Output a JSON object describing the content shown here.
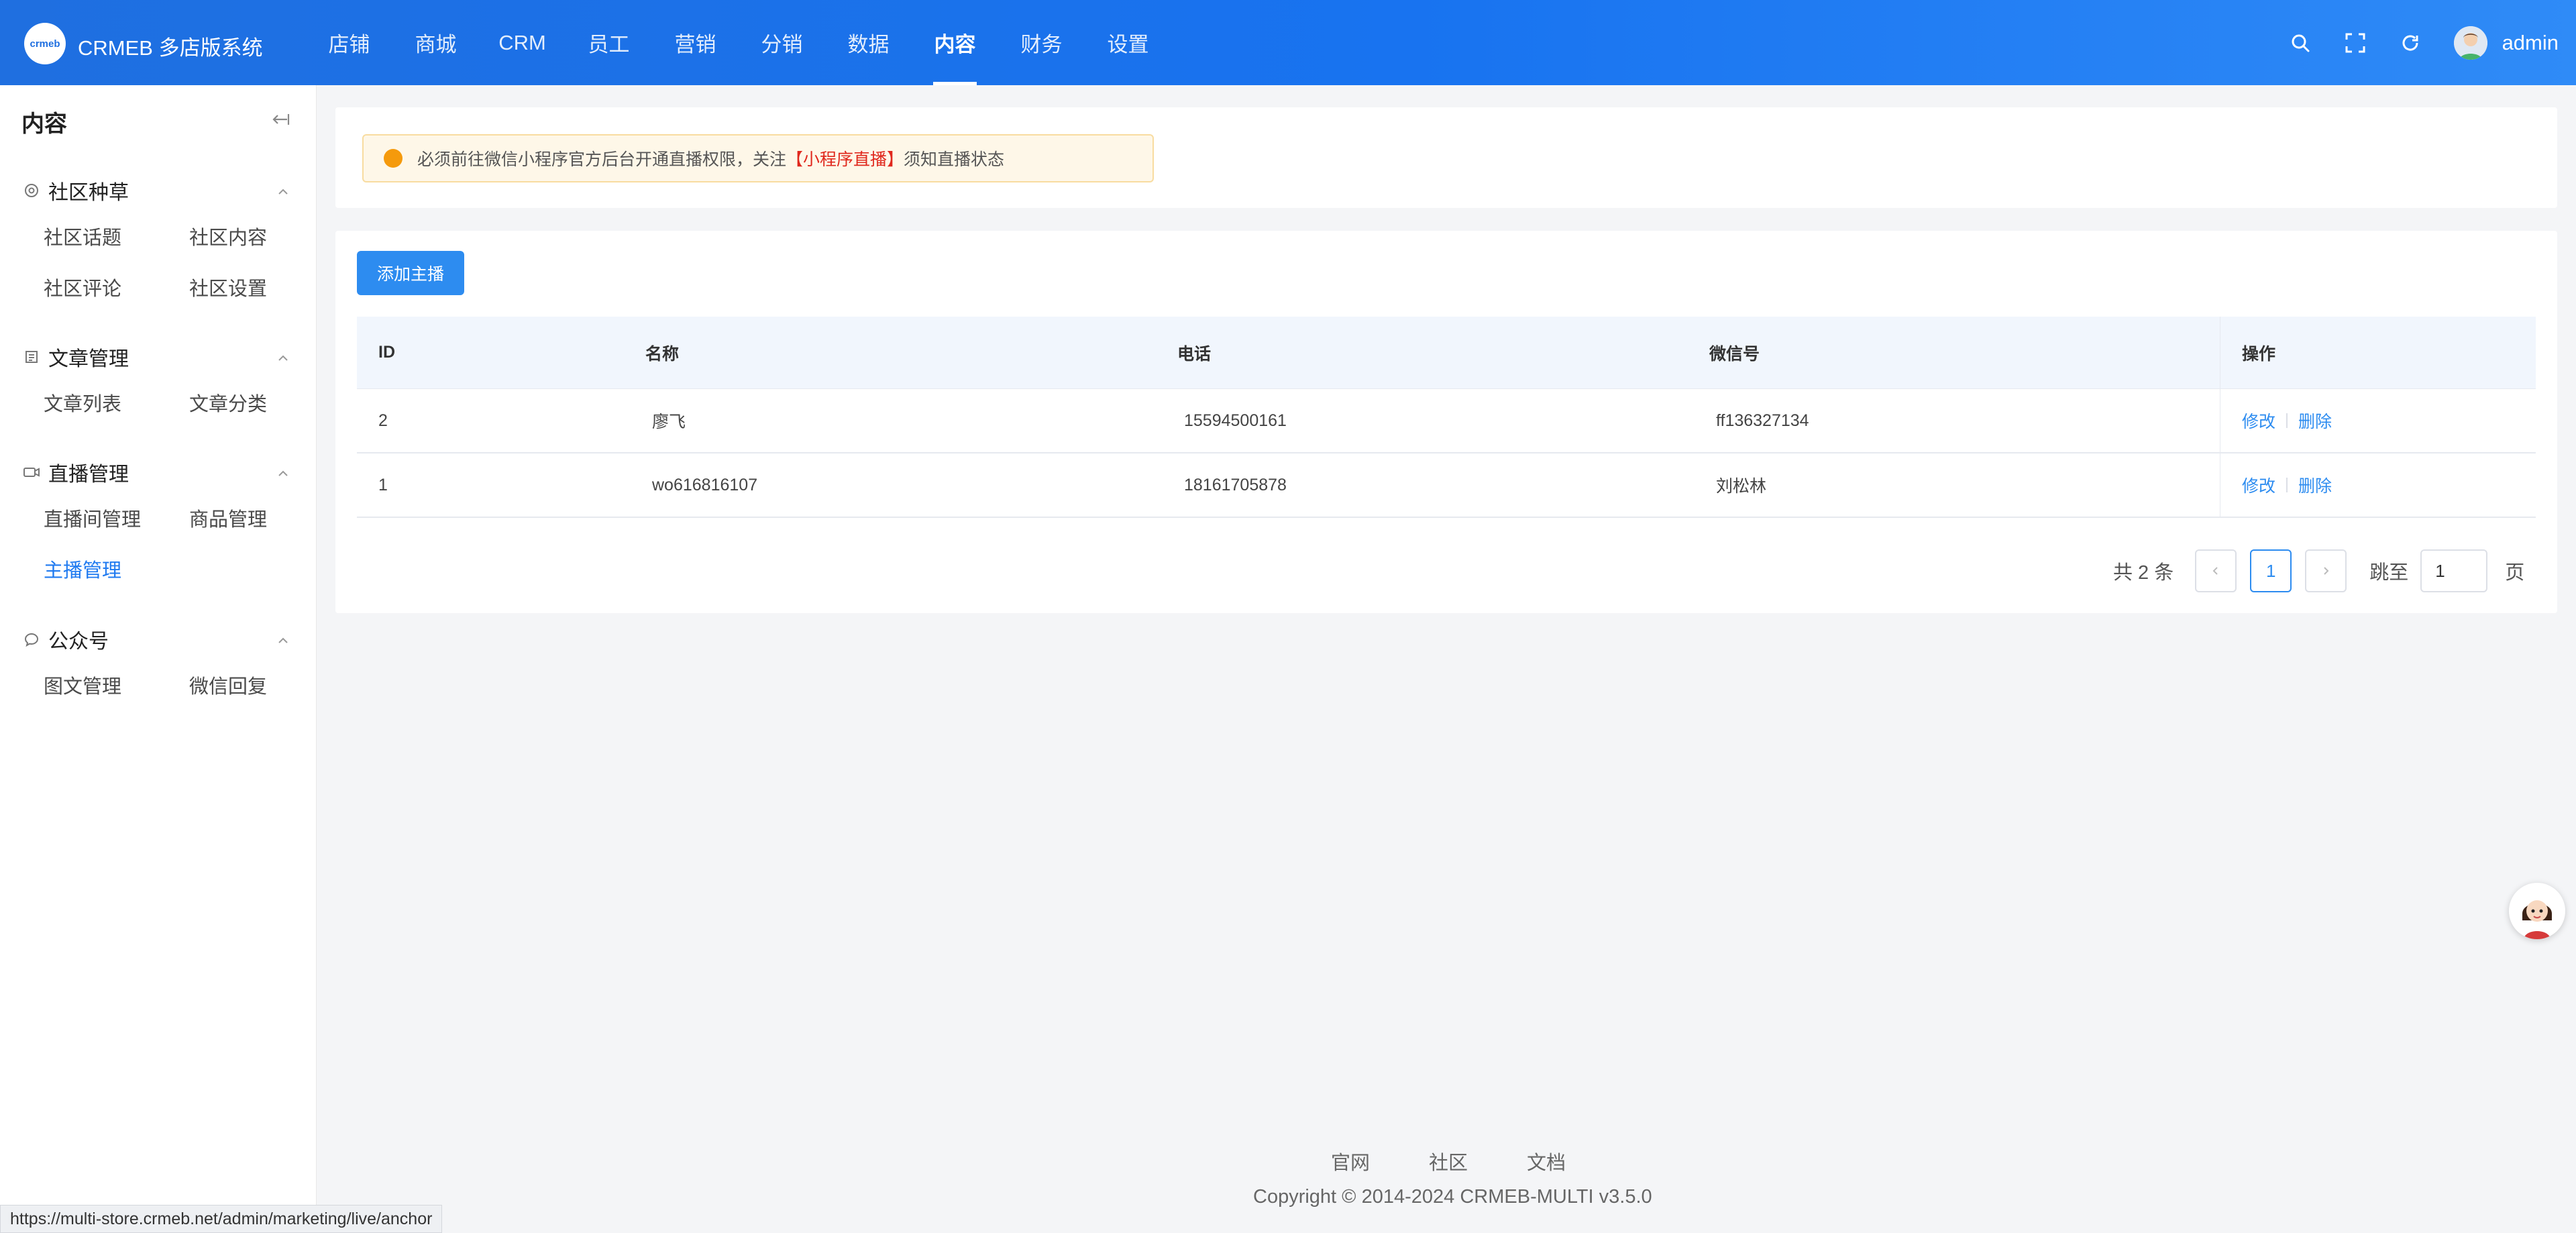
{
  "header": {
    "logo_text": "crmeb",
    "app_title": "CRMEB 多店版系统",
    "nav": [
      {
        "label": "店铺"
      },
      {
        "label": "商城"
      },
      {
        "label": "CRM"
      },
      {
        "label": "员工"
      },
      {
        "label": "营销"
      },
      {
        "label": "分销"
      },
      {
        "label": "数据"
      },
      {
        "label": "内容",
        "active": true
      },
      {
        "label": "财务"
      },
      {
        "label": "设置"
      }
    ],
    "icons": [
      "search-icon",
      "fullscreen-icon",
      "refresh-icon",
      "avatar"
    ],
    "user_name": "admin"
  },
  "sidebar": {
    "title": "内容",
    "groups": [
      {
        "label": "社区种草",
        "icon": "target-icon",
        "items": [
          {
            "label": "社区话题"
          },
          {
            "label": "社区内容"
          },
          {
            "label": "社区评论"
          },
          {
            "label": "社区设置"
          }
        ]
      },
      {
        "label": "文章管理",
        "icon": "article-icon",
        "items": [
          {
            "label": "文章列表"
          },
          {
            "label": "文章分类"
          }
        ]
      },
      {
        "label": "直播管理",
        "icon": "video-icon",
        "items": [
          {
            "label": "直播间管理"
          },
          {
            "label": "商品管理"
          },
          {
            "label": "主播管理",
            "active": true
          }
        ]
      },
      {
        "label": "公众号",
        "icon": "chat-icon",
        "items": [
          {
            "label": "图文管理"
          },
          {
            "label": "微信回复"
          }
        ]
      }
    ]
  },
  "notice": {
    "prefix": "必须前往微信小程序官方后台开通直播权限，关注",
    "highlight": "【小程序直播】",
    "suffix": "须知直播状态"
  },
  "toolbar": {
    "add_label": "添加主播"
  },
  "table": {
    "headers": [
      "ID",
      "名称",
      "电话",
      "微信号",
      "操作"
    ],
    "rows": [
      {
        "id": "2",
        "name": "廖飞",
        "phone": "15594500161",
        "wechat": "ff136327134",
        "edit": "修改",
        "delete": "删除"
      },
      {
        "id": "1",
        "name": "wo616816107",
        "phone": "18161705878",
        "wechat": "刘松林",
        "edit": "修改",
        "delete": "删除"
      }
    ]
  },
  "pagination": {
    "total": "共 2 条",
    "current_page": "1",
    "jump_label": "跳至",
    "jump_value": "1",
    "page_suffix": "页"
  },
  "footer": {
    "links": [
      "官网",
      "社区",
      "文档"
    ],
    "copyright": "Copyright © 2014-2024 CRMEB-MULTI v3.5.0"
  },
  "status_url": "https://multi-store.crmeb.net/admin/marketing/live/anchor",
  "colors": {
    "primary": "#2d8cf0",
    "header": "#1f6fe0",
    "warning": "#f59a0c",
    "highlight": "#e0281d"
  }
}
